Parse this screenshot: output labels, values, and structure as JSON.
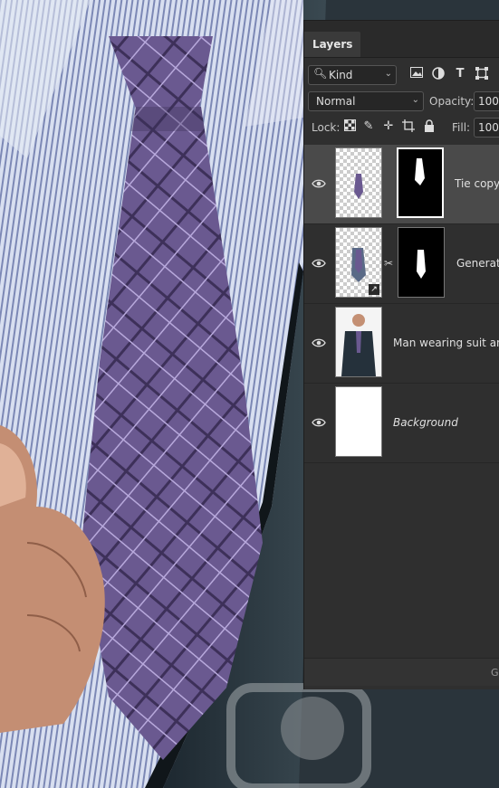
{
  "panel": {
    "tab_label": "Layers",
    "filter": {
      "kind_label": "Kind",
      "icons": [
        "image-filter-icon",
        "adjustment-filter-icon",
        "type-filter-icon",
        "shape-filter-icon"
      ]
    },
    "blend_mode": "Normal",
    "opacity_label": "Opacity:",
    "opacity_value": "100",
    "lock_label": "Lock:",
    "lock_icons": [
      "lock-transparent-icon",
      "lock-image-icon",
      "lock-position-icon",
      "lock-artboard-icon",
      "lock-all-icon"
    ],
    "fill_label": "Fill:",
    "fill_value": "100",
    "footer_glyph": "G"
  },
  "layers": [
    {
      "name": "Tie copy",
      "italic": false,
      "selected": true,
      "has_mask": true,
      "linked": false,
      "smart": false
    },
    {
      "name": "Generativ",
      "italic": false,
      "selected": false,
      "has_mask": true,
      "linked": true,
      "smart": true
    },
    {
      "name": "Man wearing suit and",
      "italic": false,
      "selected": false,
      "has_mask": false,
      "linked": false,
      "smart": false
    },
    {
      "name": "Background",
      "italic": true,
      "selected": false,
      "has_mask": false,
      "linked": false,
      "smart": false
    }
  ],
  "colors": {
    "panel_bg": "#2f2f2f",
    "selected_row": "#4a4a4a",
    "tie": "#6b5a8e",
    "suit": "#2c3b44",
    "shirt": "#c9d3ea"
  }
}
